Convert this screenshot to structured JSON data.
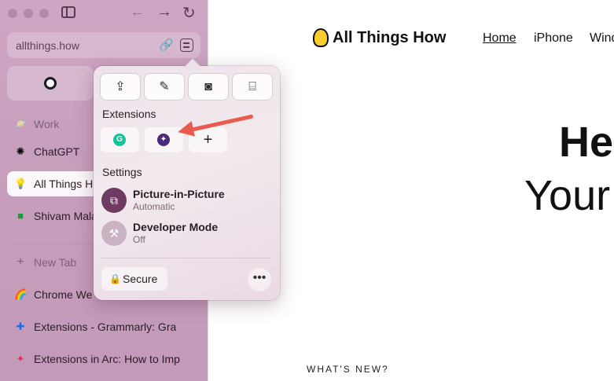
{
  "browser": {
    "url": "allthings.how",
    "navigation": {
      "back_icon": "←",
      "forward_icon": "→",
      "reload_icon": "↻"
    }
  },
  "sidebar": {
    "items": [
      {
        "label": "Work",
        "icon": "planet-icon",
        "muted": true
      },
      {
        "label": "ChatGPT",
        "icon": "chatgpt-icon"
      },
      {
        "label": "All Things H",
        "icon": "bulb-icon",
        "active": true
      },
      {
        "label": "Shivam Mala",
        "icon": "chat-icon"
      },
      {
        "label": "New Tab",
        "icon": "plus-icon",
        "muted": true
      },
      {
        "label": "Chrome We",
        "icon": "chrome-store-icon"
      },
      {
        "label": "Extensions - Grammarly: Gra",
        "icon": "puzzle-icon"
      },
      {
        "label": "Extensions in Arc: How to Imp",
        "icon": "arc-icon"
      }
    ]
  },
  "popover": {
    "tools": [
      "share-icon",
      "pin-icon",
      "camera-icon",
      "capture-icon"
    ],
    "extensions_title": "Extensions",
    "settings_title": "Settings",
    "settings": [
      {
        "title": "Picture-in-Picture",
        "subtitle": "Automatic",
        "icon": "pip-icon",
        "color": "#6e3c63"
      },
      {
        "title": "Developer Mode",
        "subtitle": "Off",
        "icon": "hammer-icon",
        "color": "#c9b3c3"
      }
    ],
    "secure_label": "Secure",
    "more_label": "•••"
  },
  "webpage": {
    "logo_text": "All Things How",
    "nav": [
      "Home",
      "iPhone",
      "Wind"
    ],
    "hero_line1": "He",
    "hero_line2": "Your",
    "whats_new": "WHAT'S NEW?"
  },
  "colors": {
    "accent_arrow": "#ea5a4f",
    "sidebar_bg": "#c9a0be"
  }
}
